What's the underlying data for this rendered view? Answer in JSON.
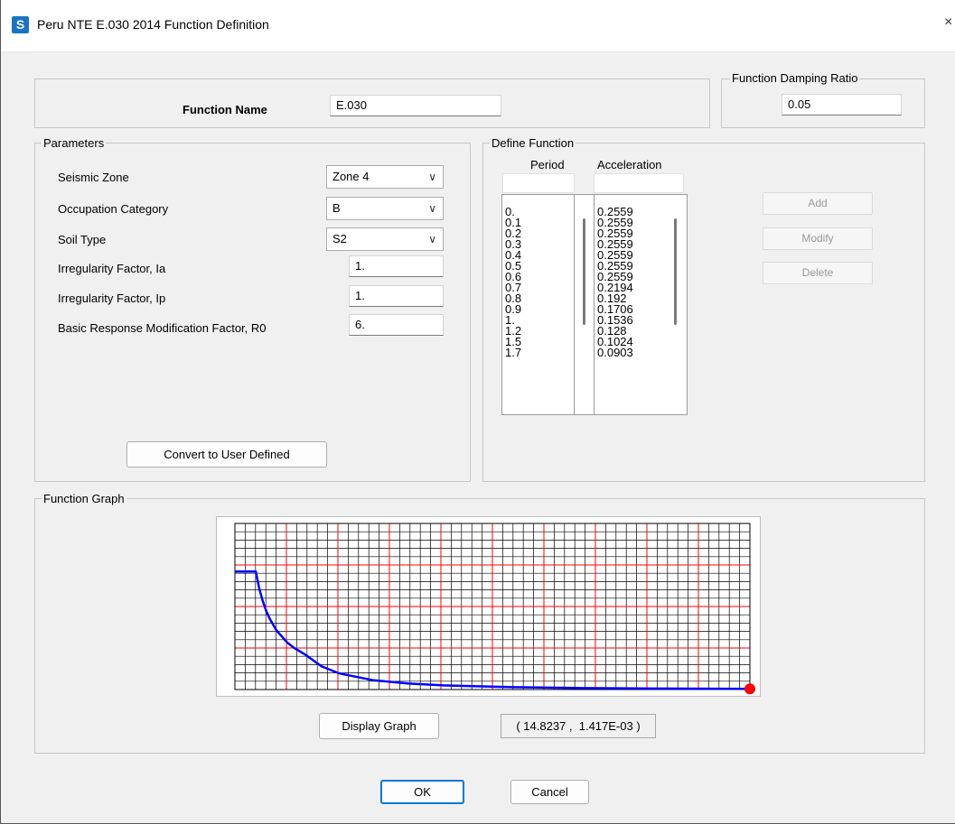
{
  "window": {
    "title": "Peru NTE E.030 2014 Function Definition",
    "icon_letter": "S",
    "close_glyph": "×"
  },
  "function_name": {
    "label": "Function Name",
    "value": "E.030"
  },
  "damping": {
    "label": "Function Damping Ratio",
    "value": "0.05"
  },
  "parameters": {
    "label": "Parameters",
    "seismic_zone": {
      "label": "Seismic Zone",
      "value": "Zone 4"
    },
    "occupation_category": {
      "label": "Occupation Category",
      "value": "B"
    },
    "soil_type": {
      "label": "Soil Type",
      "value": "S2"
    },
    "irregularity_ia": {
      "label": "Irregularity Factor, Ia",
      "value": "1."
    },
    "irregularity_ip": {
      "label": "Irregularity Factor, Ip",
      "value": "1."
    },
    "r0": {
      "label": "Basic Response Modification Factor, R0",
      "value": "6."
    },
    "convert_button": "Convert to User Defined"
  },
  "define_function": {
    "label": "Define Function",
    "period_header": "Period",
    "accel_header": "Acceleration",
    "periods": [
      "0.",
      "0.1",
      "0.2",
      "0.3",
      "0.4",
      "0.5",
      "0.6",
      "0.7",
      "0.8",
      "0.9",
      "1.",
      "1.2",
      "1.5",
      "1.7"
    ],
    "accelerations": [
      "0.2559",
      "0.2559",
      "0.2559",
      "0.2559",
      "0.2559",
      "0.2559",
      "0.2559",
      "0.2194",
      "0.192",
      "0.1706",
      "0.1536",
      "0.128",
      "0.1024",
      "0.0903"
    ],
    "add_button": "Add",
    "modify_button": "Modify",
    "delete_button": "Delete"
  },
  "graph": {
    "label": "Function Graph",
    "display_button": "Display Graph",
    "cursor_readout": "( 14.8237 ,  1.417E-03 )",
    "colors": {
      "curve": "#0000ff",
      "major_grid": "#ff0000",
      "minor_grid": "#000000",
      "marker": "#ff0000"
    }
  },
  "buttons": {
    "ok": "OK",
    "cancel": "Cancel"
  },
  "chart_data": {
    "type": "line",
    "title": "",
    "xlabel": "",
    "ylabel": "",
    "x": [
      0,
      0.4,
      0.5,
      0.6,
      0.7,
      0.8,
      0.9,
      1.0,
      1.2,
      1.5,
      1.7,
      2.0,
      2.5,
      3.0,
      4.0,
      5.0,
      6.0,
      8.0,
      10.0,
      12.0,
      14.8237
    ],
    "y": [
      0.2559,
      0.2559,
      0.2559,
      0.2559,
      0.2194,
      0.192,
      0.1706,
      0.1536,
      0.128,
      0.1024,
      0.0903,
      0.0768,
      0.05,
      0.035,
      0.02,
      0.013,
      0.009,
      0.005,
      0.0032,
      0.0022,
      0.001417
    ],
    "xlim": [
      0,
      14.8237
    ],
    "ylim": [
      0,
      0.36
    ],
    "grid": true,
    "marker_point": {
      "x": 14.8237,
      "y": 0.001417
    }
  }
}
